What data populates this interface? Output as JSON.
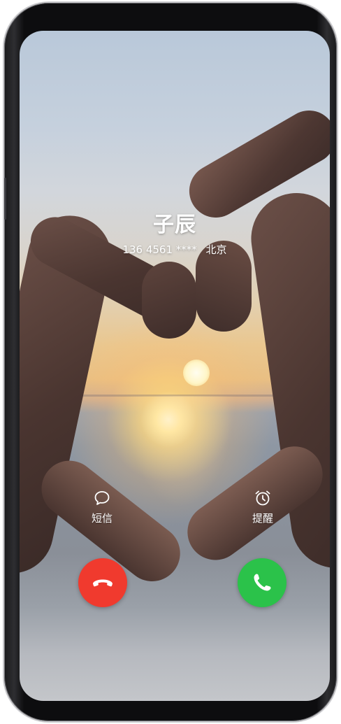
{
  "caller": {
    "name": "子辰",
    "number": "136 4561 ****",
    "location": "北京"
  },
  "quick_actions": {
    "message": {
      "label": "短信",
      "icon": "message-bubble-icon"
    },
    "remind": {
      "label": "提醒",
      "icon": "alarm-clock-icon"
    }
  },
  "call_controls": {
    "decline": {
      "icon": "phone-hangup-icon",
      "color": "#f03a2e"
    },
    "answer": {
      "icon": "phone-answer-icon",
      "color": "#2bc24a"
    }
  },
  "background": {
    "description_colors": {
      "sky_top": "#b9c8d9",
      "sunset": "#eac78f",
      "sea": "#8b929d"
    }
  }
}
